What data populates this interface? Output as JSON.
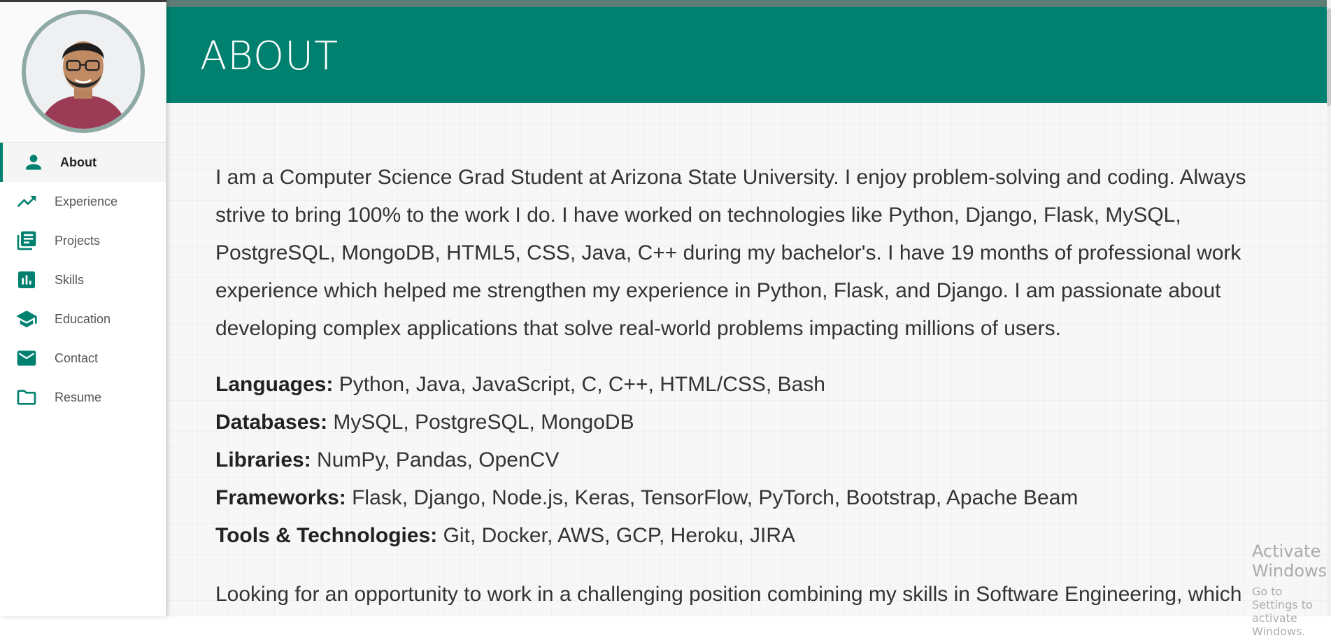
{
  "sidebar": {
    "items": [
      {
        "label": "About",
        "icon": "person-icon",
        "active": true
      },
      {
        "label": "Experience",
        "icon": "trending-up-icon"
      },
      {
        "label": "Projects",
        "icon": "library-books-icon"
      },
      {
        "label": "Skills",
        "icon": "bar-chart-icon"
      },
      {
        "label": "Education",
        "icon": "graduation-cap-icon"
      },
      {
        "label": "Contact",
        "icon": "mail-icon"
      },
      {
        "label": "Resume",
        "icon": "folder-icon"
      }
    ]
  },
  "header": {
    "title": "ABOUT"
  },
  "content": {
    "intro": "I am a Computer Science Grad Student at Arizona State University. I enjoy problem-solving and coding. Always strive to bring 100% to the work I do. I have worked on technologies like Python, Django, Flask, MySQL, PostgreSQL, MongoDB, HTML5, CSS, Java, C++ during my bachelor's. I have 19 months of professional work experience which helped me strengthen my experience in Python, Flask, and Django. I am passionate about developing complex applications that solve real-world problems impacting millions of users.",
    "skills": [
      {
        "label": "Languages:",
        "value": " Python, Java, JavaScript, C, C++, HTML/CSS, Bash"
      },
      {
        "label": "Databases:",
        "value": " MySQL, PostgreSQL, MongoDB"
      },
      {
        "label": "Libraries:",
        "value": " NumPy, Pandas, OpenCV"
      },
      {
        "label": "Frameworks:",
        "value": " Flask, Django, Node.js, Keras, TensorFlow, PyTorch, Bootstrap, Apache Beam"
      },
      {
        "label": "Tools & Technologies:",
        "value": " Git, Docker, AWS, GCP, Heroku, JIRA"
      }
    ],
    "closing": "Looking for an opportunity to work in a challenging position combining my skills in Software Engineering, which"
  },
  "watermark": {
    "title": "Activate Windows",
    "subtitle": "Go to Settings to activate Windows."
  },
  "colors": {
    "accent": "#00806f",
    "avatar_ring": "#8fa9a5"
  }
}
